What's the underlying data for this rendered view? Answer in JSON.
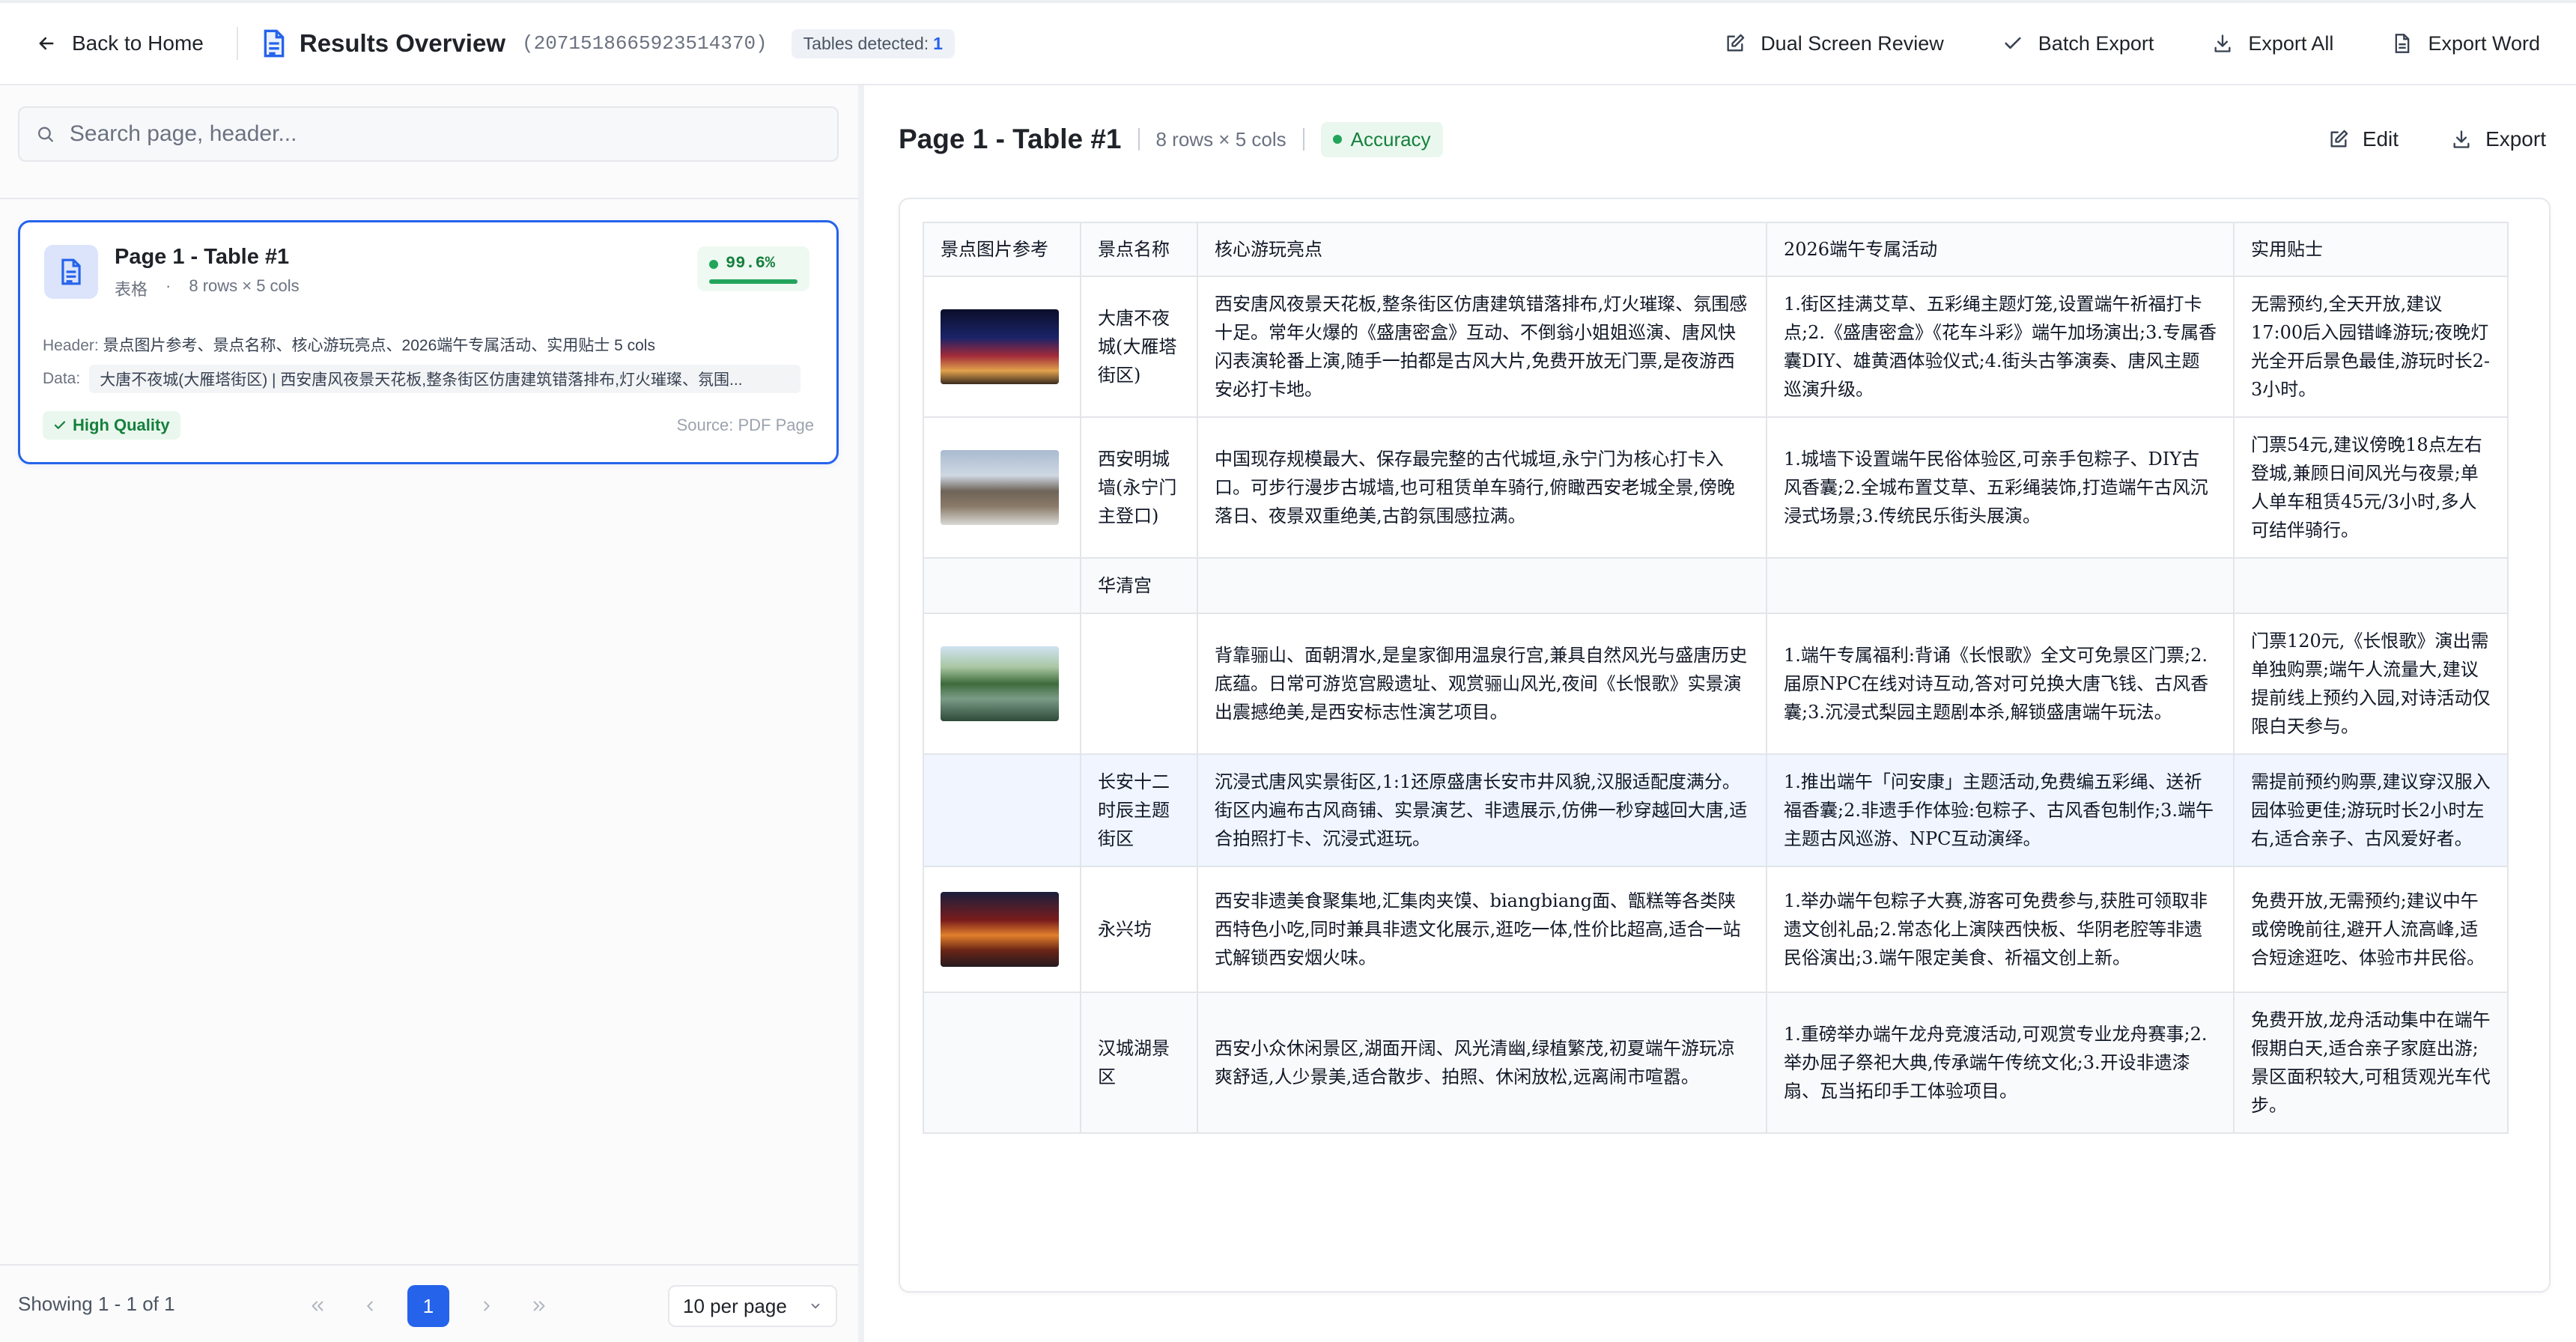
{
  "topbar": {
    "back_label": "Back to Home",
    "title": "Results Overview",
    "doc_id": "(2071518665923514370)",
    "tables_detected_label": "Tables detected:",
    "tables_detected_count": "1",
    "actions": {
      "dual_screen": "Dual Screen Review",
      "batch_export": "Batch Export",
      "export_all": "Export All",
      "export_word": "Export Word"
    }
  },
  "sidebar": {
    "search_placeholder": "Search page, header...",
    "card": {
      "title": "Page 1 - Table #1",
      "type": "表格",
      "dims": "8 rows × 5 cols",
      "score": "99.6%",
      "score_fraction": 0.996,
      "header_label": "Header:",
      "header_value": "景点图片参考、景点名称、核心游玩亮点、2026端午专属活动、实用贴士 5 cols",
      "data_label": "Data:",
      "data_value": "大唐不夜城(大雁塔街区)  |  西安唐风夜景天花板,整条街区仿唐建筑错落排布,灯火璀璨、氛围...",
      "quality": "High Quality",
      "source": "Source: PDF Page"
    },
    "pager": {
      "showing": "Showing 1 - 1 of 1",
      "current_page": "1",
      "per_page": "10 per page"
    }
  },
  "main": {
    "title": "Page 1 - Table #1",
    "dims": "8 rows × 5 cols",
    "accuracy": "Accuracy",
    "actions": {
      "edit": "Edit",
      "export": "Export"
    },
    "table": {
      "headers": [
        "景点图片参考",
        "景点名称",
        "核心游玩亮点",
        "2026端午专属活动",
        "实用贴士"
      ],
      "rows": [
        {
          "name": "大唐不夜城(大雁塔街区)",
          "highlight": "西安唐风夜景天花板,整条街区仿唐建筑错落排布,灯火璀璨、氛围感十足。常年火爆的《盛唐密盒》互动、不倒翁小姐姐巡演、唐风快闪表演轮番上演,随手一拍都是古风大片,免费开放无门票,是夜游西安必打卡地。",
          "activity": "1.街区挂满艾草、五彩绳主题灯笼,设置端午祈福打卡点;2.《盛唐密盒》《花车斗彩》端午加场演出;3.专属香囊DIY、雄黄酒体验仪式;4.街头古筝演奏、唐风主题巡演升级。",
          "tips": "无需预约,全天开放,建议17:00后入园错峰游玩;夜晚灯光全开后景色最佳,游玩时长2-3小时。"
        },
        {
          "name": "西安明城墙(永宁门主登口)",
          "highlight": "中国现存规模最大、保存最完整的古代城垣,永宁门为核心打卡入口。可步行漫步古城墙,也可租赁单车骑行,俯瞰西安老城全景,傍晚落日、夜景双重绝美,古韵氛围感拉满。",
          "activity": "1.城墙下设置端午民俗体验区,可亲手包粽子、DIY古风香囊;2.全城布置艾草、五彩绳装饰,打造端午古风沉浸式场景;3.传统民乐街头展演。",
          "tips": "门票54元,建议傍晚18点左右登城,兼顾日间风光与夜景;单人单车租赁45元/3小时,多人可结伴骑行。"
        },
        {
          "name": "华清宫",
          "highlight": "",
          "activity": "",
          "tips": ""
        },
        {
          "name": "",
          "highlight": "背靠骊山、面朝渭水,是皇家御用温泉行宫,兼具自然风光与盛唐历史底蕴。日常可游览宫殿遗址、观赏骊山风光,夜间《长恨歌》实景演出震撼绝美,是西安标志性演艺项目。",
          "activity": "1.端午专属福利:背诵《长恨歌》全文可免景区门票;2.届原NPC在线对诗互动,答对可兑换大唐飞钱、古风香囊;3.沉浸式梨园主题剧本杀,解锁盛唐端午玩法。",
          "tips": "门票120元,《长恨歌》演出需单独购票;端午人流量大,建议提前线上预约入园,对诗活动仅限白天参与。"
        },
        {
          "name": "长安十二时辰主题街区",
          "highlight": "沉浸式唐风实景街区,1:1还原盛唐长安市井风貌,汉服适配度满分。街区内遍布古风商铺、实景演艺、非遗展示,仿佛一秒穿越回大唐,适合拍照打卡、沉浸式逛玩。",
          "activity": "1.推出端午「问安康」主题活动,免费编五彩绳、送祈福香囊;2.非遗手作体验:包粽子、古风香包制作;3.端午主题古风巡游、NPC互动演绎。",
          "tips": "需提前预约购票,建议穿汉服入园体验更佳;游玩时长2小时左右,适合亲子、古风爱好者。"
        },
        {
          "name": "永兴坊",
          "highlight": "西安非遗美食聚集地,汇集肉夹馍、biangbiang面、甑糕等各类陕西特色小吃,同时兼具非遗文化展示,逛吃一体,性价比超高,适合一站式解锁西安烟火味。",
          "activity": "1.举办端午包粽子大赛,游客可免费参与,获胜可领取非遗文创礼品;2.常态化上演陕西快板、华阴老腔等非遗民俗演出;3.端午限定美食、祈福文创上新。",
          "tips": "免费开放,无需预约;建议中午或傍晚前往,避开人流高峰,适合短途逛吃、体验市井民俗。"
        },
        {
          "name": "汉城湖景区",
          "highlight": "西安小众休闲景区,湖面开阔、风光清幽,绿植繁茂,初夏端午游玩凉爽舒适,人少景美,适合散步、拍照、休闲放松,远离闹市喧嚣。",
          "activity": "1.重磅举办端午龙舟竞渡活动,可观赏专业龙舟赛事;2.举办屈子祭祀大典,传承端午传统文化;3.开设非遗漆扇、瓦当拓印手工体验项目。",
          "tips": "免费开放,龙舟活动集中在端午假期白天,适合亲子家庭出游;景区面积较大,可租赁观光车代步。"
        }
      ]
    }
  }
}
